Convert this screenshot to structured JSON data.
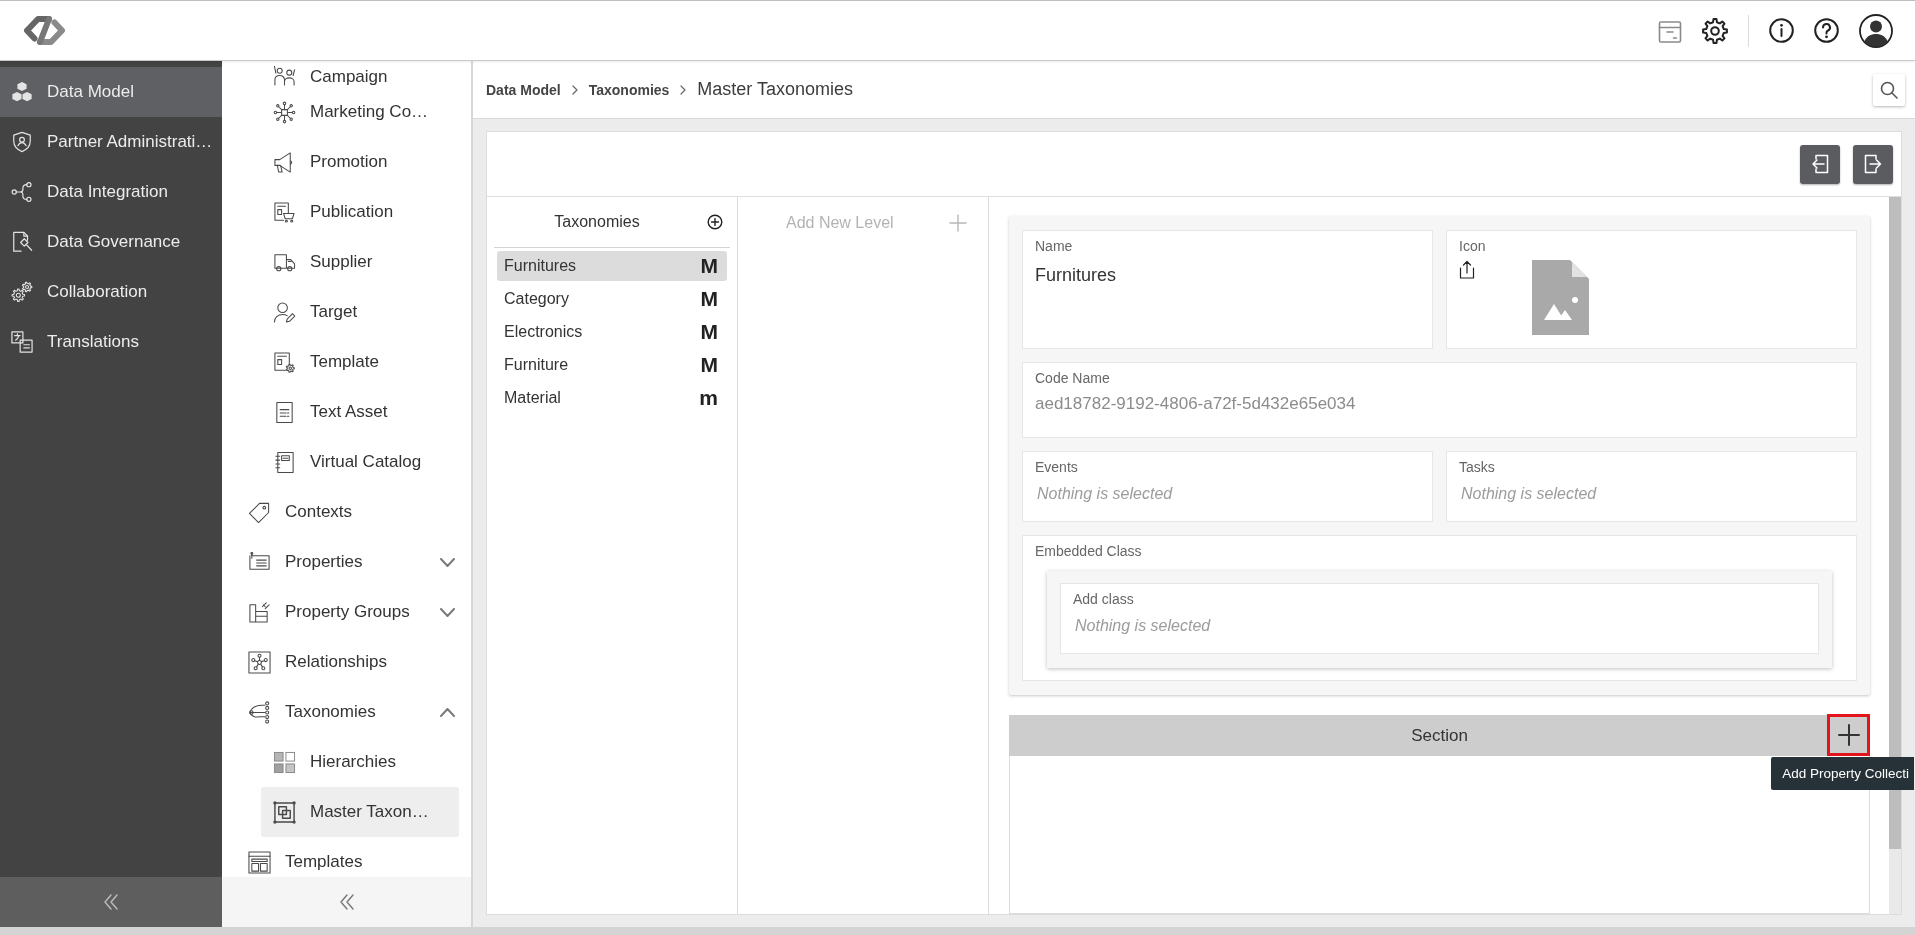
{
  "main_nav": {
    "items": [
      {
        "label": "Data Model",
        "selected": true
      },
      {
        "label": "Partner Administrati…",
        "selected": false
      },
      {
        "label": "Data Integration",
        "selected": false
      },
      {
        "label": "Data Governance",
        "selected": false
      },
      {
        "label": "Collaboration",
        "selected": false
      },
      {
        "label": "Translations",
        "selected": false
      }
    ]
  },
  "sub_nav": {
    "items": [
      {
        "children": [
          {
            "label": "Campaign",
            "selected": false
          },
          {
            "label": "Marketing Co…",
            "selected": false
          },
          {
            "label": "Promotion",
            "selected": false
          },
          {
            "label": "Publication",
            "selected": false
          },
          {
            "label": "Supplier",
            "selected": false
          },
          {
            "label": "Target",
            "selected": false
          },
          {
            "label": "Template",
            "selected": false
          },
          {
            "label": "Text Asset",
            "selected": false
          },
          {
            "label": "Virtual Catalog",
            "selected": false
          }
        ]
      },
      {
        "label": "Contexts",
        "selected": false
      },
      {
        "label": "Properties",
        "selected": false,
        "expanded": false
      },
      {
        "label": "Property Groups",
        "selected": false,
        "expanded": false
      },
      {
        "label": "Relationships",
        "selected": false
      },
      {
        "label": "Taxonomies",
        "selected": false,
        "expanded": true,
        "children": [
          {
            "label": "Hierarchies",
            "selected": false
          },
          {
            "label": "Master Taxon…",
            "selected": true
          }
        ]
      },
      {
        "label": "Templates",
        "selected": false
      }
    ]
  },
  "breadcrumb": {
    "items": [
      {
        "label": "Data Model"
      },
      {
        "label": "Taxonomies"
      },
      {
        "label": "Master Taxonomies"
      }
    ]
  },
  "taxonomies": {
    "title": "Taxonomies",
    "items": [
      {
        "label": "Furnitures",
        "marker": "M",
        "selected": true
      },
      {
        "label": "Category",
        "marker": "M",
        "selected": false
      },
      {
        "label": "Electronics",
        "marker": "M",
        "selected": false
      },
      {
        "label": "Furniture",
        "marker": "M",
        "selected": false
      },
      {
        "label": "Material",
        "marker": "m",
        "selected": false
      }
    ]
  },
  "levels": {
    "placeholder": "Add New Level"
  },
  "details": {
    "name": {
      "label": "Name",
      "value": "Furnitures"
    },
    "icon": {
      "label": "Icon"
    },
    "code_name": {
      "label": "Code Name",
      "value": "aed18782-9192-4806-a72f-5d432e65e034",
      "disabled": true
    },
    "events": {
      "label": "Events",
      "placeholder": "Nothing is selected"
    },
    "tasks": {
      "label": "Tasks",
      "placeholder": "Nothing is selected"
    },
    "embedded_class": {
      "label": "Embedded Class",
      "add_class": {
        "label": "Add class",
        "placeholder": "Nothing is selected"
      }
    }
  },
  "section": {
    "title": "Section",
    "add_button": {
      "highlighted": true,
      "tooltip": "Add Property Collecti"
    }
  }
}
